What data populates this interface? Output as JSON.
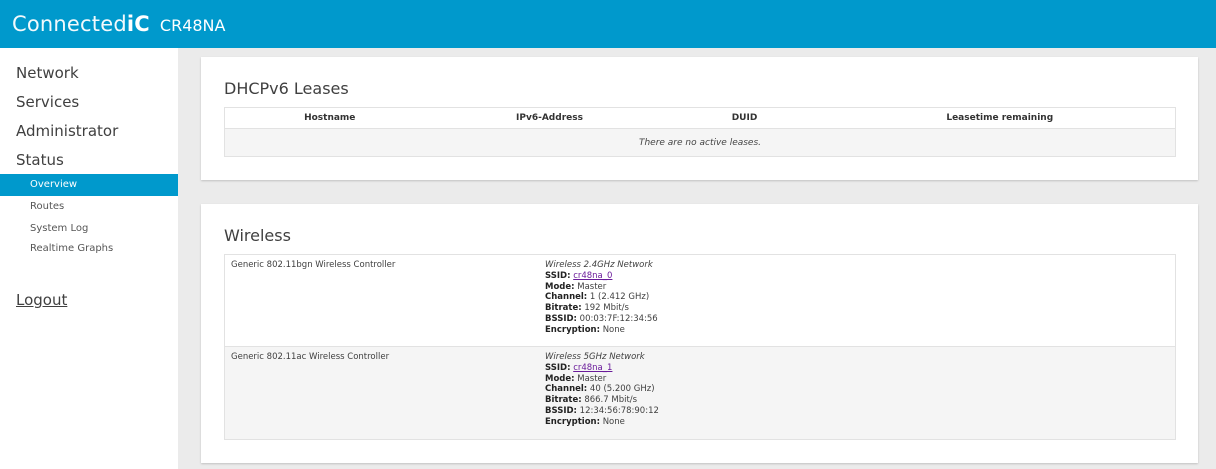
{
  "header": {
    "brand_light": "Connected",
    "brand_bold": "iC",
    "model": "CR48NA"
  },
  "sidebar": {
    "menu": [
      "Network",
      "Services",
      "Administrator",
      "Status"
    ],
    "status_items": [
      "Overview",
      "Routes",
      "System Log",
      "Realtime Graphs"
    ],
    "active_item": "Overview",
    "logout": "Logout"
  },
  "dhcp": {
    "title": "DHCPv6 Leases",
    "columns": [
      "Hostname",
      "IPv6-Address",
      "DUID",
      "Leasetime remaining"
    ],
    "empty": "There are no active leases."
  },
  "wireless": {
    "title": "Wireless",
    "labels": {
      "ssid": "SSID:",
      "mode": "Mode:",
      "channel": "Channel:",
      "bitrate": "Bitrate:",
      "bssid": "BSSID:",
      "encryption": "Encryption:"
    },
    "devices": [
      {
        "controller": "Generic 802.11bgn Wireless Controller",
        "network": "Wireless 2.4GHz Network",
        "ssid": "cr48na_0",
        "mode": "Master",
        "channel": "1 (2.412 GHz)",
        "bitrate": "192 Mbit/s",
        "bssid": "00:03:7F:12:34:56",
        "encryption": "None"
      },
      {
        "controller": "Generic 802.11ac Wireless Controller",
        "network": "Wireless 5GHz Network",
        "ssid": "cr48na_1",
        "mode": "Master",
        "channel": "40 (5.200 GHz)",
        "bitrate": "866.7 Mbit/s",
        "bssid": "12:34:56:78:90:12",
        "encryption": "None"
      }
    ]
  }
}
